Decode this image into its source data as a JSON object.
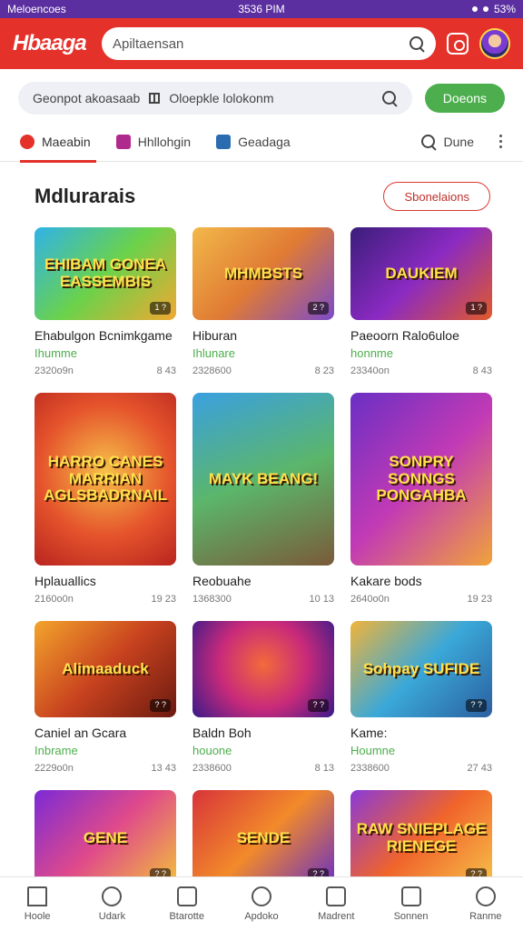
{
  "status_bar": {
    "left": "Meloencoes",
    "time": "3536 PIM",
    "right": "53%"
  },
  "app_bar": {
    "logo": "Hbaaga",
    "search_placeholder": "Apiltaensan"
  },
  "filter_bar": {
    "filter1": "Geonpot akoasaab",
    "filter2": "Oloepkle lolokonm",
    "go_label": "Doeons"
  },
  "tabs": [
    {
      "label": "Maeabin",
      "color": "#e4322b"
    },
    {
      "label": "Hhllohgin",
      "color": "#b02a8e"
    },
    {
      "label": "Geadaga",
      "color": "#2b6cb0"
    },
    {
      "label": "Dune",
      "color": "#555555"
    }
  ],
  "section": {
    "title": "Mdlurarais",
    "button": "Sbonelaions"
  },
  "games": [
    {
      "thumb_text": "EHIBAM GONEA EASSEMBIS",
      "badge": "1 ?",
      "title": "Ehabulgon Bcnimkgame",
      "category": "Ihumme",
      "downloads": "2320o9n",
      "rating": "8 43",
      "bg": "linear-gradient(135deg,#2fb3e8,#6bd24a,#f0a832)",
      "size": "short"
    },
    {
      "thumb_text": "MHMBSTS",
      "badge": "2 ?",
      "title": "Hiburan",
      "category": "Ihlunare",
      "downloads": "2328600",
      "rating": "8 23",
      "bg": "linear-gradient(135deg,#f2b84a,#e07b34,#7b4bc9)",
      "size": "short"
    },
    {
      "thumb_text": "DAUKIEM",
      "badge": "1 ?",
      "title": "Paeoorn Ralo6uloe",
      "category": "honnme",
      "downloads": "23340on",
      "rating": "8 43",
      "bg": "linear-gradient(135deg,#3a1e7a,#8b2ac2,#e05a2a)",
      "size": "short"
    },
    {
      "thumb_text": "HARRO CANES MARRIAN AGLSBADRNAIL",
      "badge": "",
      "title": "Hplauallics",
      "category": "",
      "downloads": "2160o0n",
      "rating": "19 23",
      "bg": "radial-gradient(circle at 50% 45%,#f7c14a,#e5542c 55%,#b8241f)",
      "size": "tall"
    },
    {
      "thumb_text": "MAYK BEANG!",
      "badge": "",
      "title": "Reobuahe",
      "category": "",
      "downloads": "1368300",
      "rating": "10 13",
      "bg": "linear-gradient(160deg,#3aa0e0,#5bb66a,#7a5a3a)",
      "size": "tall"
    },
    {
      "thumb_text": "SONPRY SONNGS PONGAHBA",
      "badge": "",
      "title": "Kakare bods",
      "category": "",
      "downloads": "2640o0n",
      "rating": "19 23",
      "bg": "linear-gradient(135deg,#6a2fc4,#c23ab5,#f0a33a)",
      "size": "tall"
    },
    {
      "thumb_text": "Alimaaduck",
      "badge": "? ?",
      "title": "Caniel an Gcara",
      "category": "Inbrame",
      "downloads": "2229o0n",
      "rating": "13 43",
      "bg": "linear-gradient(135deg,#f3a42c,#c8421f,#6b1a10)",
      "size": "mid"
    },
    {
      "thumb_text": "",
      "badge": "? ?",
      "title": "Baldn Boh",
      "category": "houone",
      "downloads": "2338600",
      "rating": "8 13",
      "bg": "radial-gradient(circle at 50% 45%,#f36a3a,#c82a7a 50%,#3a1a8a)",
      "size": "mid"
    },
    {
      "thumb_text": "Sohpay SUFIDE",
      "badge": "? ?",
      "title": "Kame:",
      "category": "Houmne",
      "downloads": "2338600",
      "rating": "27 43",
      "bg": "linear-gradient(135deg,#f0b43a,#3aa8d8,#2b5fa0)",
      "size": "mid"
    },
    {
      "thumb_text": "GENE",
      "badge": "? ?",
      "title": "",
      "category": "",
      "downloads": "",
      "rating": "",
      "bg": "linear-gradient(135deg,#7b2ad6,#e04a8a,#f2c03a)",
      "size": "mid"
    },
    {
      "thumb_text": "SENDE",
      "badge": "? ?",
      "title": "",
      "category": "",
      "downloads": "",
      "rating": "",
      "bg": "linear-gradient(135deg,#d8343a,#f28a2a,#6a2fc4)",
      "size": "mid"
    },
    {
      "thumb_text": "RAW SNIEPLAGE RIENEGE",
      "badge": "? ?",
      "title": "",
      "category": "",
      "downloads": "",
      "rating": "",
      "bg": "linear-gradient(135deg,#8a3ad8,#f0642a,#f7c14a)",
      "size": "mid"
    }
  ],
  "bottom_nav": [
    {
      "label": "Hoole",
      "icon": "home-icon"
    },
    {
      "label": "Udark",
      "icon": "search-icon"
    },
    {
      "label": "Btarotte",
      "icon": "grid-icon"
    },
    {
      "label": "Apdoko",
      "icon": "compass-icon"
    },
    {
      "label": "Madrent",
      "icon": "folder-icon"
    },
    {
      "label": "Sonnen",
      "icon": "chat-icon"
    },
    {
      "label": "Ranme",
      "icon": "profile-icon"
    }
  ]
}
